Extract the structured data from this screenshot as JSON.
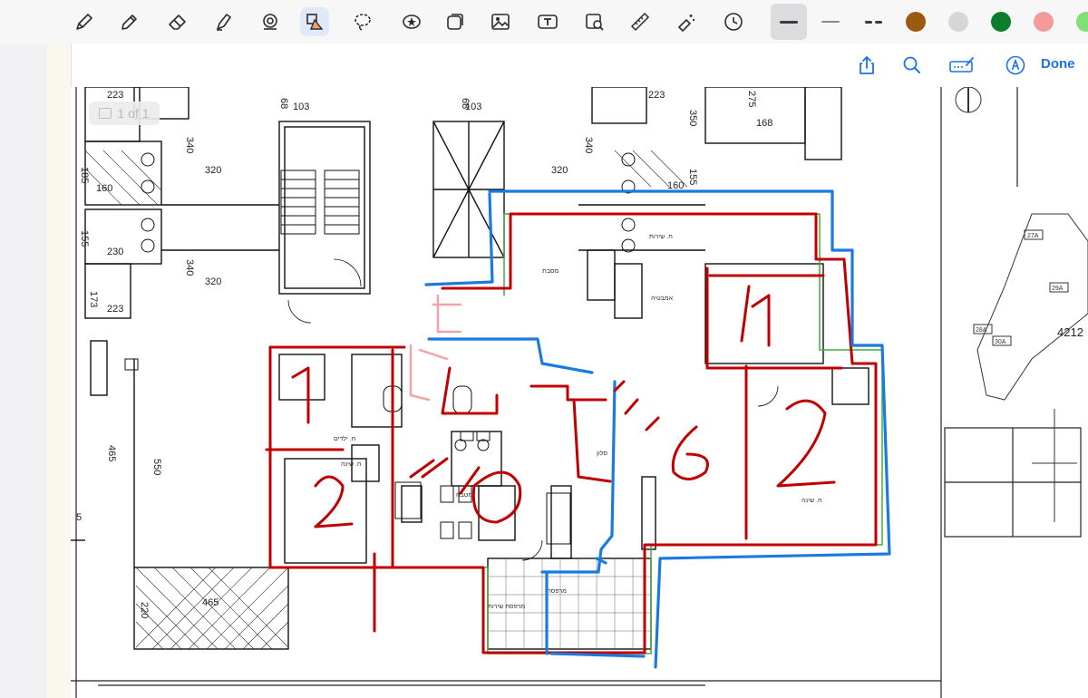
{
  "toolbar": {
    "tools": [
      {
        "icon": "pen-icon"
      },
      {
        "icon": "pencil-icon"
      },
      {
        "icon": "eraser-icon"
      },
      {
        "icon": "highlighter-icon"
      },
      {
        "icon": "shape-recognition-icon"
      },
      {
        "icon": "shapes-icon",
        "active": true
      },
      {
        "icon": "lasso-icon"
      },
      {
        "icon": "stamp-icon"
      },
      {
        "icon": "sticky-note-icon"
      },
      {
        "icon": "image-icon"
      },
      {
        "icon": "text-box-icon"
      },
      {
        "icon": "image-search-icon"
      },
      {
        "icon": "ruler-icon"
      },
      {
        "icon": "magic-eraser-icon"
      },
      {
        "icon": "clock-icon"
      }
    ],
    "line_styles": [
      {
        "name": "thick-line",
        "active": true
      },
      {
        "name": "thin-line",
        "active": false
      },
      {
        "name": "dashed-line",
        "active": false
      }
    ],
    "colors": [
      "#9a5a10",
      "#d6d6d6",
      "#0b7d2b",
      "#f39a9a",
      "#7fe07a"
    ]
  },
  "secondary_toolbar": {
    "share_icon": "share-icon",
    "search_icon": "search-icon",
    "signature_icon": "signature-icon",
    "markup_icon": "markup-icon",
    "done_label": "Done"
  },
  "page_badge": {
    "label": "1 of 1"
  },
  "plan": {
    "dimensions": [
      "223",
      "103",
      "68",
      "340",
      "320",
      "160",
      "185",
      "155",
      "230",
      "173",
      "465",
      "550",
      "220",
      "275",
      "350",
      "168",
      "5"
    ],
    "plot_code": "4212",
    "lot_labels": [
      "27A",
      "29A",
      "28A",
      "30A"
    ]
  },
  "annotations": {
    "numbers": [
      "1",
      "2",
      "1",
      "2",
      "1",
      "2",
      "10",
      "6"
    ],
    "pen_colors": {
      "red": "#c00000",
      "blue": "#1a7ae0",
      "pink": "#f2a3a3"
    }
  }
}
